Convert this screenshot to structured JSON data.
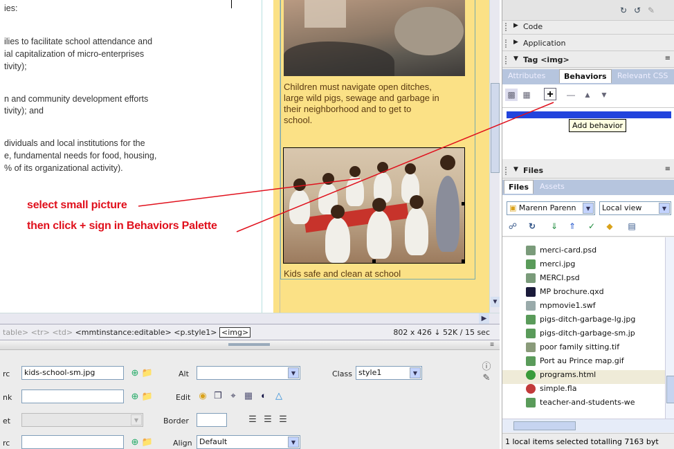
{
  "document": {
    "left_lines": [
      "ies:",
      "ilies to facilitate school attendance and",
      "ial capitalization of micro-enterprises",
      "tivity);",
      "n and community development efforts",
      "tivity); and",
      "dividuals and local institutions for the",
      "e, fundamental needs for food, housing,",
      "% of its organizational activity)."
    ],
    "caption1": [
      "Children must navigate open ditches,",
      "large wild pigs, sewage and garbage in",
      "their neighborhood and to get to",
      "school."
    ],
    "caption2": "Kids safe and clean at school"
  },
  "annotations": {
    "line1": "select small picture",
    "line2": "then click + sign in Behaviors Palette"
  },
  "tag_selector": {
    "faded": "table> <tr> <td>",
    "path": "<mmtinstance:editable> <p.style1>",
    "selected_tag": "<img>",
    "status": "802 x 426 ↓ 52K / 15 sec"
  },
  "inspector": {
    "src_label": "rc",
    "src_value": "kids-school-sm.jpg",
    "link_label": "nk",
    "target_label": "et",
    "low_label": "rc",
    "alt_label": "Alt",
    "edit_label": "Edit",
    "border_label": "Border",
    "align_label": "Align",
    "align_value": "Default",
    "class_label": "Class",
    "class_value": "style1"
  },
  "panels": {
    "code": "Code",
    "application": "Application",
    "tag": "Tag <img>",
    "tabs": [
      "Attributes",
      "Behaviors",
      "Relevant CSS"
    ],
    "tooltip": "Add behavior",
    "files_header": "Files",
    "files_tabs": [
      "Files",
      "Assets"
    ],
    "site": "Marenn Parenn",
    "view": "Local view",
    "files": [
      "merci-card.psd",
      "merci.jpg",
      "MERCI.psd",
      "MP brochure.qxd",
      "mpmovie1.swf",
      "pigs-ditch-garbage-lg.jpg",
      "pigs-ditch-garbage-sm.jp",
      "poor family sitting.tif",
      "Port au Prince map.gif",
      "programs.html",
      "simple.fla",
      "teacher-and-students-we"
    ],
    "status": "1 local items selected totalling 7163 byt"
  },
  "colors": {
    "column_bg": "#fbe186",
    "annotation": "#e0101c",
    "caption": "#5b3a12"
  }
}
